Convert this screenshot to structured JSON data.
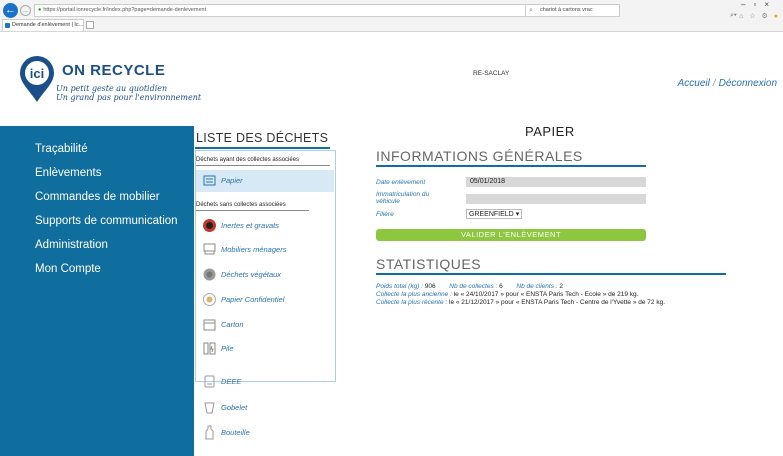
{
  "browser": {
    "url": "https://portail.ionrecycle.fr/index.php?page=demande-denlevement",
    "search_text": "chariot à cartons vrac",
    "tab_title": "Demande d'enlèvement | Ic...",
    "close_tab": "×"
  },
  "header": {
    "brand": "ON RECYCLE",
    "logo_text": "ici",
    "slogan_line1": "Un petit geste au quotidien",
    "slogan_line2": "Un grand pas pour l'environnement",
    "site_name": "RE-SACLAY",
    "link_home": "Accueil",
    "link_separator": "/",
    "link_logout": "Déconnexion"
  },
  "sidebar": {
    "items": [
      {
        "label": "Traçabilité"
      },
      {
        "label": "Enlèvements"
      },
      {
        "label": "Commandes de mobilier"
      },
      {
        "label": "Supports de communication"
      },
      {
        "label": "Administration"
      },
      {
        "label": "Mon Compte"
      }
    ]
  },
  "waste_list": {
    "title": "LISTE DES DÉCHETS",
    "group_with": "Déchets ayant des collectes associées",
    "group_without": "Déchets sans collectes associées",
    "items": [
      {
        "label": "Papier",
        "icon": "paper-icon",
        "active": true
      },
      {
        "label": "Inertes et gravats",
        "icon": "rubble-icon"
      },
      {
        "label": "Mobiliers ménagers",
        "icon": "furniture-icon"
      },
      {
        "label": "Déchets végétaux",
        "icon": "plant-waste-icon"
      },
      {
        "label": "Papier Confidentiel",
        "icon": "confidential-paper-icon"
      },
      {
        "label": "Carton",
        "icon": "cardboard-icon"
      },
      {
        "label": "Pile",
        "icon": "battery-icon"
      },
      {
        "label": "DEEE",
        "icon": "electronics-icon"
      },
      {
        "label": "Gobelet",
        "icon": "cup-icon"
      },
      {
        "label": "Bouteille",
        "icon": "bottle-icon"
      }
    ]
  },
  "main": {
    "title": "PAPIER",
    "general_title": "INFORMATIONS GÉNÉRALES",
    "fields": {
      "date_label": "Date enlèvement",
      "date_value": "05/01/2018",
      "plate_label_line1": "Immatriculation du",
      "plate_label_line2": "véhicule",
      "plate_value": "",
      "sector_label": "Filière",
      "sector_value": "GREENFIELD"
    },
    "validate_label": "VALIDER L'ENLÈVEMENT",
    "stats_title": "STATISTIQUES",
    "stats": {
      "weight_label": "Poids total (kg) :",
      "weight_value": "906",
      "collects_label": "Nb de collectes :",
      "collects_value": "6",
      "clients_label": "Nb de clients :",
      "clients_value": "2",
      "oldest_label": "Collecte la plus ancienne :",
      "oldest_value": "le « 24/10/2017 » pour « ENSTA Paris Tech - Ecole » de 219 kg.",
      "latest_label": "Collecte la plus récente :",
      "latest_value": "le « 21/12/2017 » pour « ENSTA Paris Tech - Centre de l'Yvette » de 72 kg."
    }
  },
  "colors": {
    "sidebar_bg": "#0f6e9e",
    "link_blue": "#2873b0",
    "validate_green": "#8dc63f",
    "brand_blue": "#1b4f8a"
  }
}
